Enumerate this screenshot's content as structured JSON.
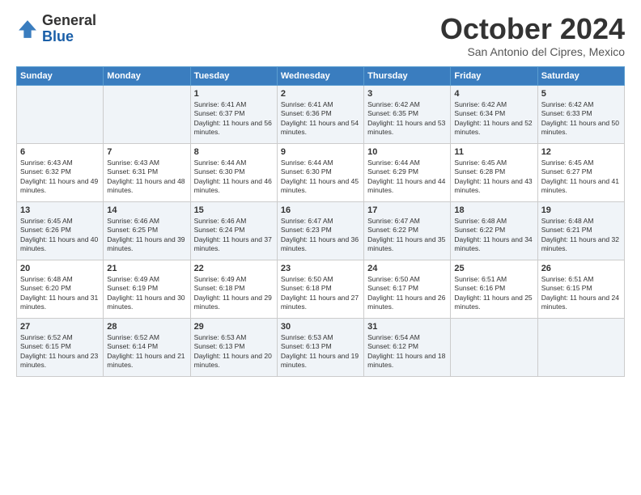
{
  "logo": {
    "general": "General",
    "blue": "Blue"
  },
  "header": {
    "month": "October 2024",
    "location": "San Antonio del Cipres, Mexico"
  },
  "weekdays": [
    "Sunday",
    "Monday",
    "Tuesday",
    "Wednesday",
    "Thursday",
    "Friday",
    "Saturday"
  ],
  "weeks": [
    [
      {
        "day": "",
        "sunrise": "",
        "sunset": "",
        "daylight": ""
      },
      {
        "day": "",
        "sunrise": "",
        "sunset": "",
        "daylight": ""
      },
      {
        "day": "1",
        "sunrise": "Sunrise: 6:41 AM",
        "sunset": "Sunset: 6:37 PM",
        "daylight": "Daylight: 11 hours and 56 minutes."
      },
      {
        "day": "2",
        "sunrise": "Sunrise: 6:41 AM",
        "sunset": "Sunset: 6:36 PM",
        "daylight": "Daylight: 11 hours and 54 minutes."
      },
      {
        "day": "3",
        "sunrise": "Sunrise: 6:42 AM",
        "sunset": "Sunset: 6:35 PM",
        "daylight": "Daylight: 11 hours and 53 minutes."
      },
      {
        "day": "4",
        "sunrise": "Sunrise: 6:42 AM",
        "sunset": "Sunset: 6:34 PM",
        "daylight": "Daylight: 11 hours and 52 minutes."
      },
      {
        "day": "5",
        "sunrise": "Sunrise: 6:42 AM",
        "sunset": "Sunset: 6:33 PM",
        "daylight": "Daylight: 11 hours and 50 minutes."
      }
    ],
    [
      {
        "day": "6",
        "sunrise": "Sunrise: 6:43 AM",
        "sunset": "Sunset: 6:32 PM",
        "daylight": "Daylight: 11 hours and 49 minutes."
      },
      {
        "day": "7",
        "sunrise": "Sunrise: 6:43 AM",
        "sunset": "Sunset: 6:31 PM",
        "daylight": "Daylight: 11 hours and 48 minutes."
      },
      {
        "day": "8",
        "sunrise": "Sunrise: 6:44 AM",
        "sunset": "Sunset: 6:30 PM",
        "daylight": "Daylight: 11 hours and 46 minutes."
      },
      {
        "day": "9",
        "sunrise": "Sunrise: 6:44 AM",
        "sunset": "Sunset: 6:30 PM",
        "daylight": "Daylight: 11 hours and 45 minutes."
      },
      {
        "day": "10",
        "sunrise": "Sunrise: 6:44 AM",
        "sunset": "Sunset: 6:29 PM",
        "daylight": "Daylight: 11 hours and 44 minutes."
      },
      {
        "day": "11",
        "sunrise": "Sunrise: 6:45 AM",
        "sunset": "Sunset: 6:28 PM",
        "daylight": "Daylight: 11 hours and 43 minutes."
      },
      {
        "day": "12",
        "sunrise": "Sunrise: 6:45 AM",
        "sunset": "Sunset: 6:27 PM",
        "daylight": "Daylight: 11 hours and 41 minutes."
      }
    ],
    [
      {
        "day": "13",
        "sunrise": "Sunrise: 6:45 AM",
        "sunset": "Sunset: 6:26 PM",
        "daylight": "Daylight: 11 hours and 40 minutes."
      },
      {
        "day": "14",
        "sunrise": "Sunrise: 6:46 AM",
        "sunset": "Sunset: 6:25 PM",
        "daylight": "Daylight: 11 hours and 39 minutes."
      },
      {
        "day": "15",
        "sunrise": "Sunrise: 6:46 AM",
        "sunset": "Sunset: 6:24 PM",
        "daylight": "Daylight: 11 hours and 37 minutes."
      },
      {
        "day": "16",
        "sunrise": "Sunrise: 6:47 AM",
        "sunset": "Sunset: 6:23 PM",
        "daylight": "Daylight: 11 hours and 36 minutes."
      },
      {
        "day": "17",
        "sunrise": "Sunrise: 6:47 AM",
        "sunset": "Sunset: 6:22 PM",
        "daylight": "Daylight: 11 hours and 35 minutes."
      },
      {
        "day": "18",
        "sunrise": "Sunrise: 6:48 AM",
        "sunset": "Sunset: 6:22 PM",
        "daylight": "Daylight: 11 hours and 34 minutes."
      },
      {
        "day": "19",
        "sunrise": "Sunrise: 6:48 AM",
        "sunset": "Sunset: 6:21 PM",
        "daylight": "Daylight: 11 hours and 32 minutes."
      }
    ],
    [
      {
        "day": "20",
        "sunrise": "Sunrise: 6:48 AM",
        "sunset": "Sunset: 6:20 PM",
        "daylight": "Daylight: 11 hours and 31 minutes."
      },
      {
        "day": "21",
        "sunrise": "Sunrise: 6:49 AM",
        "sunset": "Sunset: 6:19 PM",
        "daylight": "Daylight: 11 hours and 30 minutes."
      },
      {
        "day": "22",
        "sunrise": "Sunrise: 6:49 AM",
        "sunset": "Sunset: 6:18 PM",
        "daylight": "Daylight: 11 hours and 29 minutes."
      },
      {
        "day": "23",
        "sunrise": "Sunrise: 6:50 AM",
        "sunset": "Sunset: 6:18 PM",
        "daylight": "Daylight: 11 hours and 27 minutes."
      },
      {
        "day": "24",
        "sunrise": "Sunrise: 6:50 AM",
        "sunset": "Sunset: 6:17 PM",
        "daylight": "Daylight: 11 hours and 26 minutes."
      },
      {
        "day": "25",
        "sunrise": "Sunrise: 6:51 AM",
        "sunset": "Sunset: 6:16 PM",
        "daylight": "Daylight: 11 hours and 25 minutes."
      },
      {
        "day": "26",
        "sunrise": "Sunrise: 6:51 AM",
        "sunset": "Sunset: 6:15 PM",
        "daylight": "Daylight: 11 hours and 24 minutes."
      }
    ],
    [
      {
        "day": "27",
        "sunrise": "Sunrise: 6:52 AM",
        "sunset": "Sunset: 6:15 PM",
        "daylight": "Daylight: 11 hours and 23 minutes."
      },
      {
        "day": "28",
        "sunrise": "Sunrise: 6:52 AM",
        "sunset": "Sunset: 6:14 PM",
        "daylight": "Daylight: 11 hours and 21 minutes."
      },
      {
        "day": "29",
        "sunrise": "Sunrise: 6:53 AM",
        "sunset": "Sunset: 6:13 PM",
        "daylight": "Daylight: 11 hours and 20 minutes."
      },
      {
        "day": "30",
        "sunrise": "Sunrise: 6:53 AM",
        "sunset": "Sunset: 6:13 PM",
        "daylight": "Daylight: 11 hours and 19 minutes."
      },
      {
        "day": "31",
        "sunrise": "Sunrise: 6:54 AM",
        "sunset": "Sunset: 6:12 PM",
        "daylight": "Daylight: 11 hours and 18 minutes."
      },
      {
        "day": "",
        "sunrise": "",
        "sunset": "",
        "daylight": ""
      },
      {
        "day": "",
        "sunrise": "",
        "sunset": "",
        "daylight": ""
      }
    ]
  ]
}
